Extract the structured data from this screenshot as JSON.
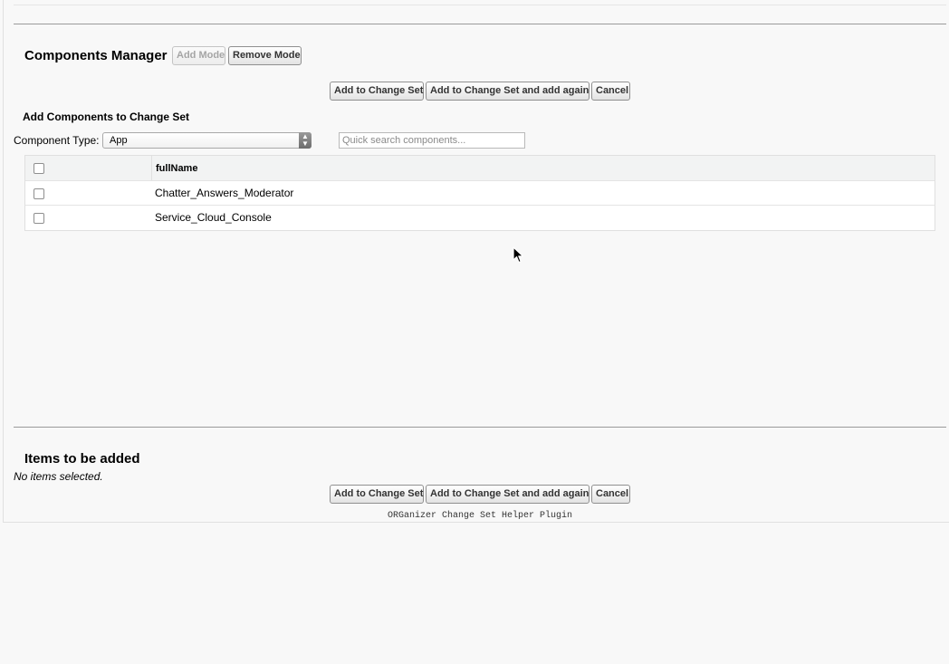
{
  "components_manager": {
    "title": "Components Manager",
    "add_mode_label": "Add Mode",
    "remove_mode_label": "Remove Mode"
  },
  "top_actions": {
    "add_label": "Add to Change Set",
    "add_again_label": "Add to Change Set and add again",
    "cancel_label": "Cancel"
  },
  "add_components": {
    "heading": "Add Components to Change Set",
    "component_type_label": "Component Type:",
    "component_type_value": "App",
    "search_placeholder": "Quick search components..."
  },
  "table": {
    "column_header": "fullName",
    "rows": [
      {
        "name": "Chatter_Answers_Moderator",
        "checked": false
      },
      {
        "name": "Service_Cloud_Console",
        "checked": false
      }
    ]
  },
  "items_to_add": {
    "title": "Items to be added",
    "empty_text": "No items selected."
  },
  "bottom_actions": {
    "add_label": "Add to Change Set",
    "add_again_label": "Add to Change Set and add again",
    "cancel_label": "Cancel"
  },
  "footer": {
    "text": "ORGanizer Change Set Helper Plugin"
  },
  "icons": {
    "select_arrow": "updown-chevron-icon",
    "cursor": "mouse-pointer-icon"
  }
}
